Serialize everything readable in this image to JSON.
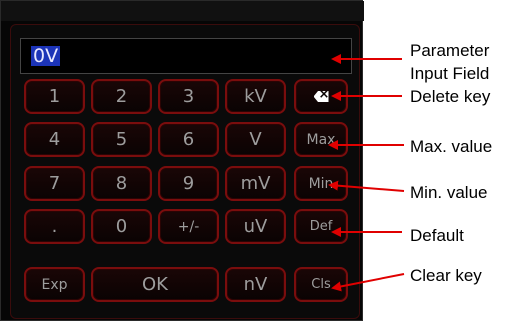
{
  "input": {
    "value": "0V"
  },
  "keys": {
    "row1": [
      "1",
      "2",
      "3",
      "kV"
    ],
    "row2": [
      "4",
      "5",
      "6",
      "V",
      "Max"
    ],
    "row3": [
      "7",
      "8",
      "9",
      "mV",
      "Min"
    ],
    "row4": [
      ".",
      "0",
      "+/-",
      "uV",
      "Def"
    ],
    "row5": [
      "Exp",
      "OK",
      "nV",
      "Cls"
    ],
    "delete_icon": "backspace-icon"
  },
  "annotations": {
    "parameter_input_line1": "Parameter",
    "parameter_input_line2": "Input Field",
    "delete_key": "Delete key",
    "max_value": "Max. value",
    "min_value": "Min. value",
    "default": "Default",
    "clear_key": "Clear key"
  },
  "colors": {
    "key_border": "#7a0d0d",
    "input_highlight": "#1c34b8",
    "panel_background": "#060606"
  }
}
